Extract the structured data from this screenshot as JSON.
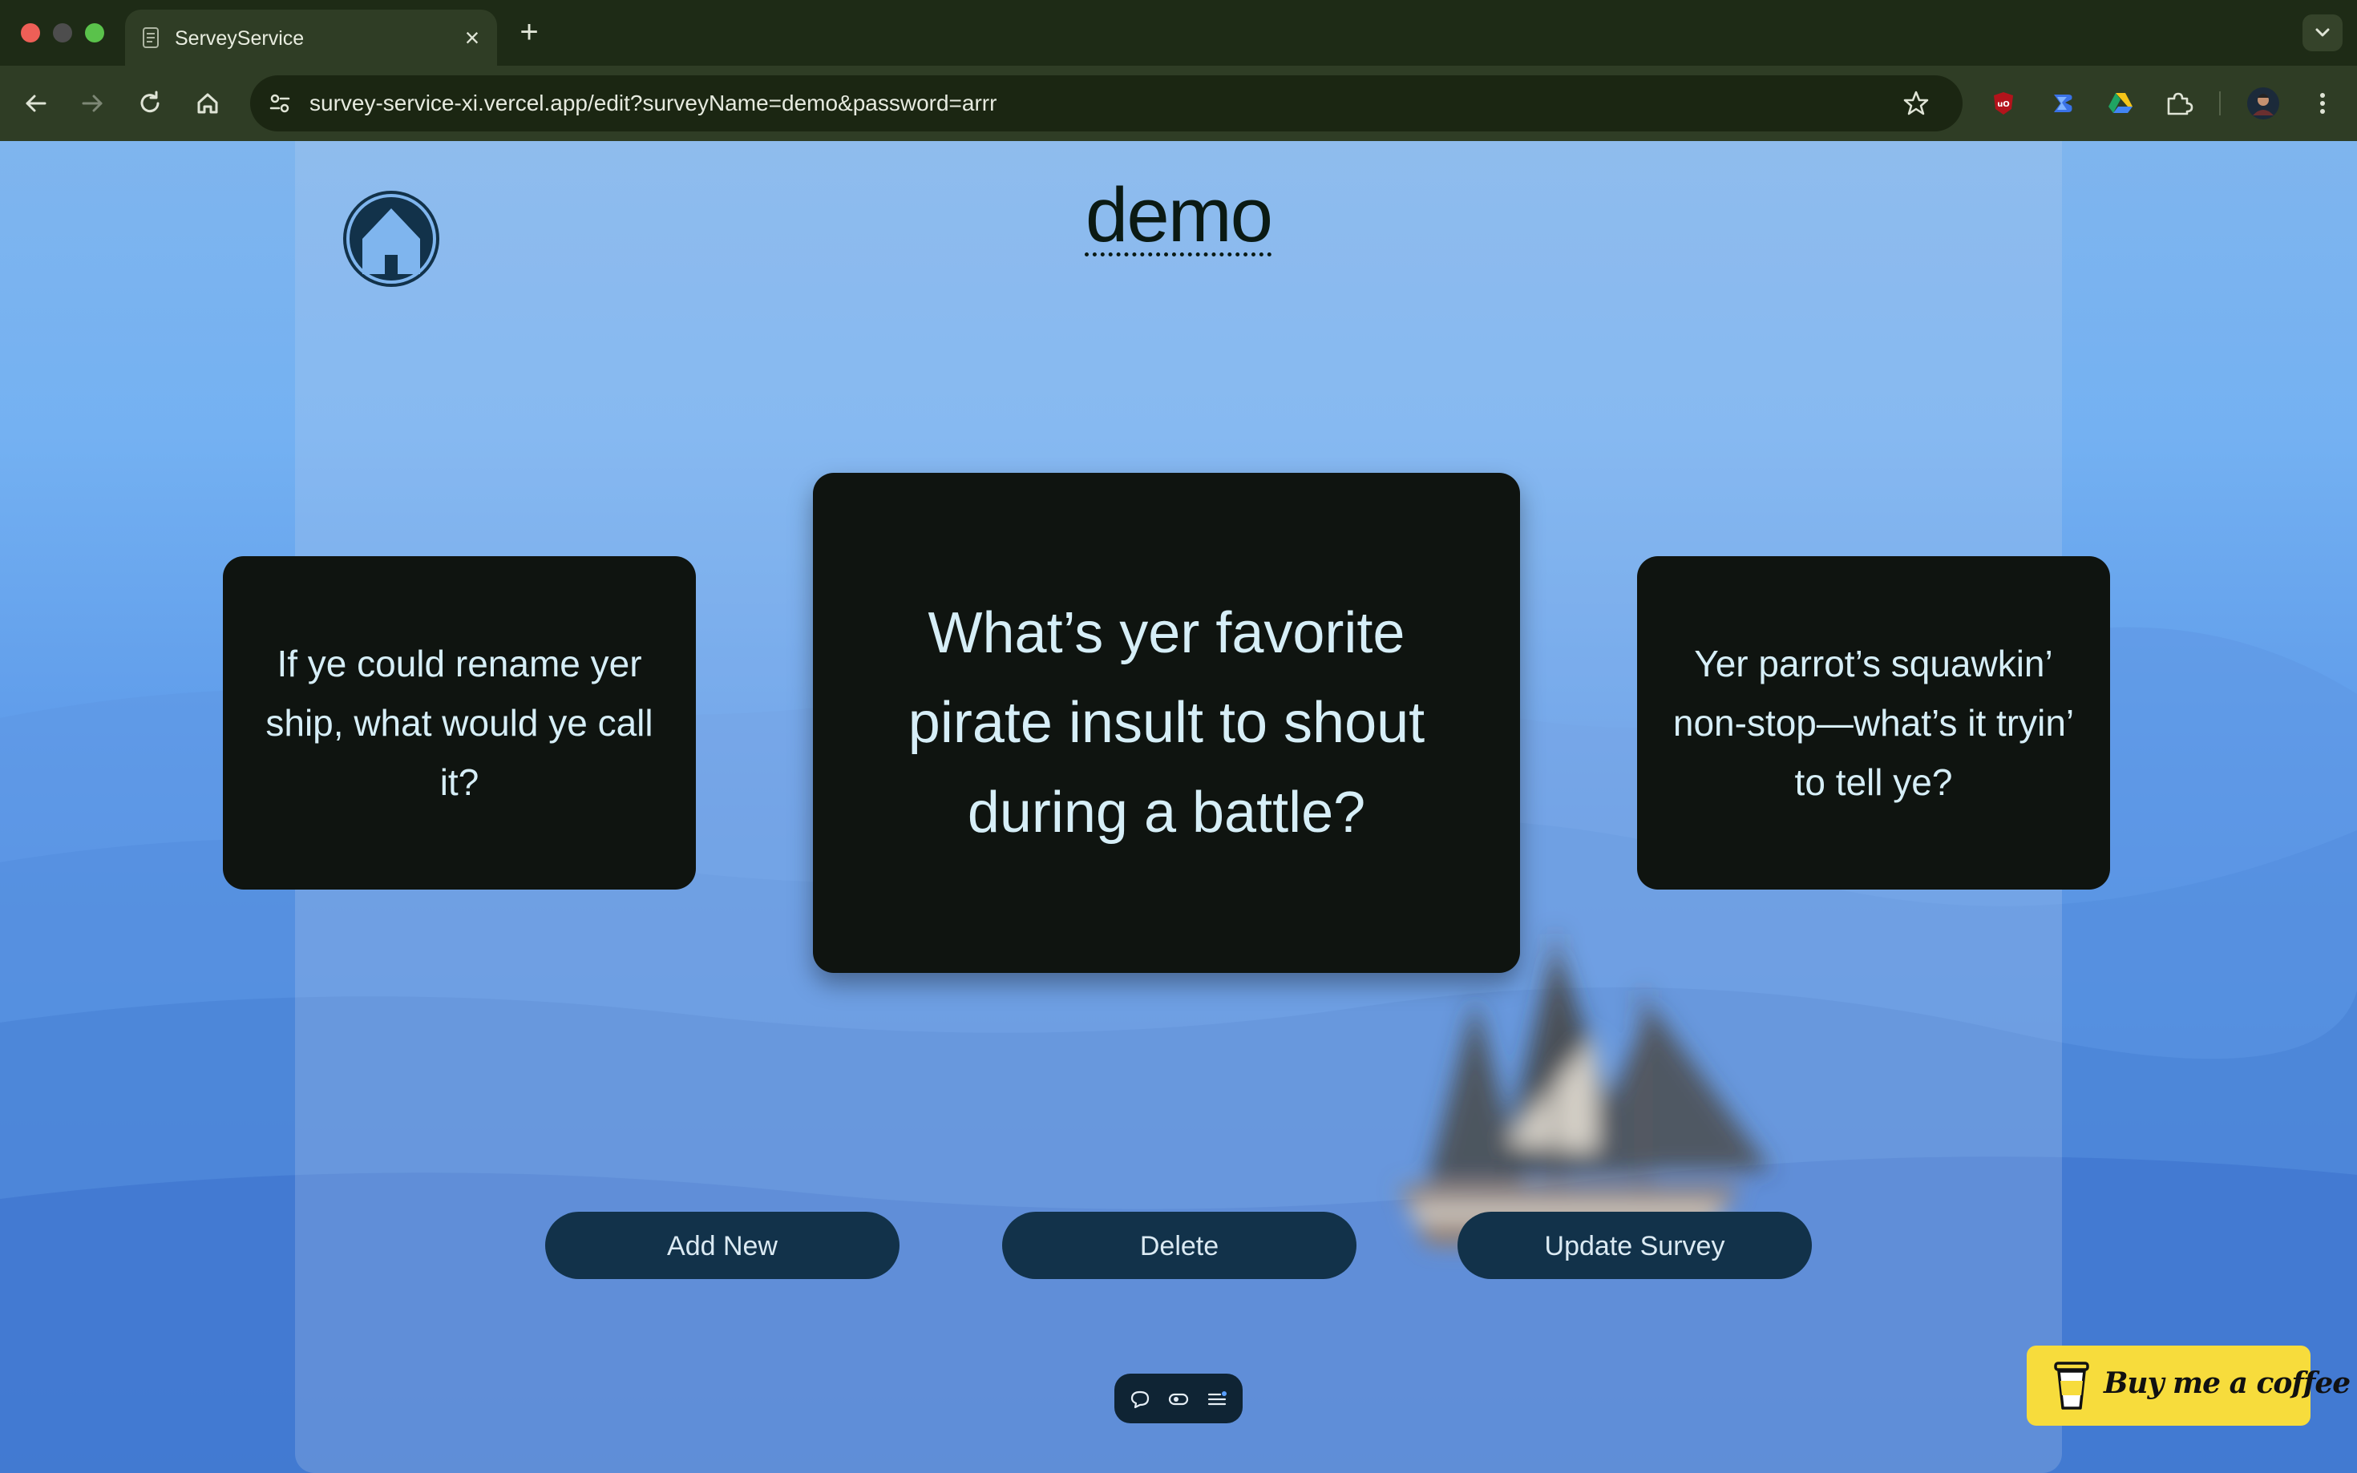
{
  "browser": {
    "tab_title": "ServeyService",
    "url": "survey-service-xi.vercel.app/edit?surveyName=demo&password=arrr"
  },
  "page": {
    "title": "demo",
    "cards": {
      "previous": "If ye could rename yer ship, what would ye call it?",
      "current": "What’s yer favorite pirate insult to shout during a battle?",
      "next": "Yer parrot’s squawkin’ non-stop—what’s it tryin’ to tell ye?"
    },
    "buttons": {
      "add": "Add New",
      "delete": "Delete",
      "update": "Update Survey"
    },
    "coffee_label": "Buy me a coffee"
  },
  "icons": {
    "tab": "document-icon",
    "back": "back-arrow-icon",
    "forward": "forward-arrow-icon",
    "reload": "reload-icon",
    "home": "home-icon",
    "bookmark": "star-icon",
    "extensions": "puzzle-icon",
    "menu": "kebab-menu-icon"
  },
  "colors": {
    "card_bg": "#0f1410",
    "card_text": "#d6eef7",
    "button_bg": "#12324a",
    "coffee_bg": "#f7dc3c"
  }
}
